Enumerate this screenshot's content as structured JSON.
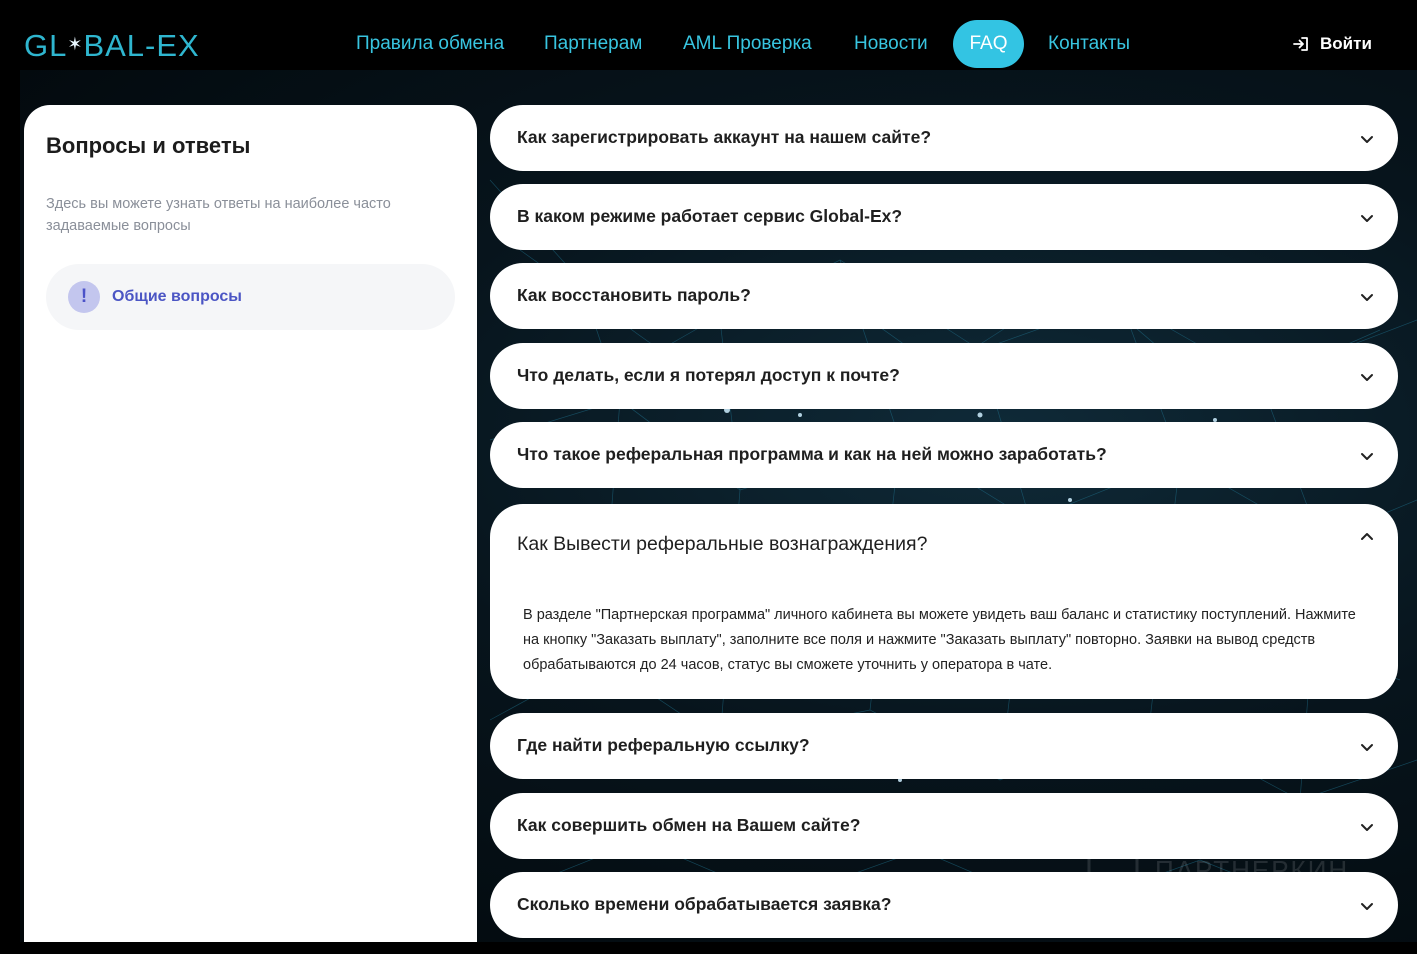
{
  "header": {
    "logo": {
      "left": "GL",
      "star": "✶",
      "right": "BAL-EX"
    },
    "nav": [
      {
        "label": "Правила обмена",
        "active": false
      },
      {
        "label": "Партнерам",
        "active": false
      },
      {
        "label": "AML Проверка",
        "active": false
      },
      {
        "label": "Новости",
        "active": false
      },
      {
        "label": "FAQ",
        "active": true
      },
      {
        "label": "Контакты",
        "active": false
      }
    ],
    "login_label": "Войти"
  },
  "sidebar": {
    "title": "Вопросы и ответы",
    "description": "Здесь вы можете узнать ответы на наиболее часто задаваемые вопросы",
    "categories": [
      {
        "badge": "!",
        "label": "Общие вопросы"
      }
    ]
  },
  "faq": {
    "items": [
      {
        "question": "Как зарегистрировать аккаунт на нашем сайте?",
        "open": false
      },
      {
        "question": "В каком режиме работает сервис Global-Ex?",
        "open": false
      },
      {
        "question": "Как восстановить пароль?",
        "open": false
      },
      {
        "question": "Что делать, если я потерял доступ к почте?",
        "open": false
      },
      {
        "question": "Что такое реферальная программа и как на ней можно заработать?",
        "open": false
      },
      {
        "question": "Как Вывести реферальные вознаграждения?",
        "open": true,
        "answer": "В разделе \"Партнерская программа\" личного кабинета вы можете увидеть ваш баланс и статистику поступлений. Нажмите на кнопку \"Заказать выплату\", заполните все поля и нажмите \"Заказать выплату\" повторно. Заявки на вывод средств обрабатываются до 24 часов, статус вы сможете уточнить у оператора в чате."
      },
      {
        "question": "Где найти реферальную ссылку?",
        "open": false
      },
      {
        "question": "Как совершить обмен на Вашем сайте?",
        "open": false
      },
      {
        "question": "Сколько времени обрабатывается заявка?",
        "open": false
      }
    ]
  },
  "watermark": {
    "text": "ПАРТНЕРКИН"
  },
  "colors": {
    "accent": "#33c4e3",
    "nav_text": "#38c5e0",
    "category_text": "#4b55c4",
    "badge_bg": "#c3c6ee"
  },
  "icons": {
    "login": "login-arrow-icon",
    "chevron_down": "chevron-down-icon",
    "chevron_up": "chevron-up-icon"
  }
}
